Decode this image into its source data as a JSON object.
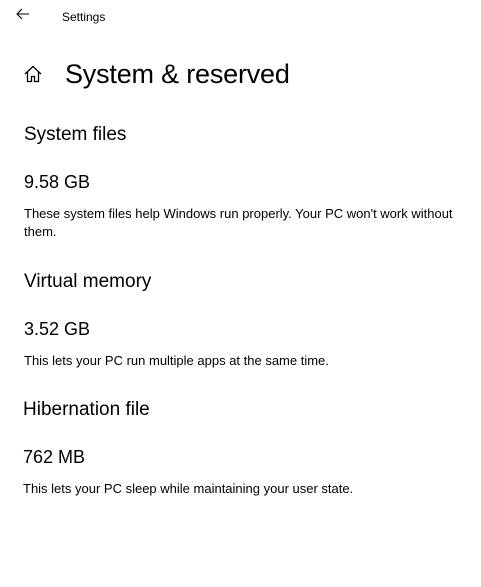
{
  "window": {
    "app_title": "Settings",
    "back_icon": "back-arrow-icon"
  },
  "header": {
    "home_icon": "home-icon",
    "title": "System & reserved"
  },
  "sections": [
    {
      "heading": "System files",
      "value": "9.58 GB",
      "description": "These system files help Windows run properly. Your PC won't work without them."
    },
    {
      "heading": "Virtual memory",
      "value": "3.52 GB",
      "description": "This lets your PC run multiple apps at the same time."
    },
    {
      "heading": "Hibernation file",
      "value": "762 MB",
      "description": "This lets your PC sleep while maintaining your user state."
    }
  ]
}
